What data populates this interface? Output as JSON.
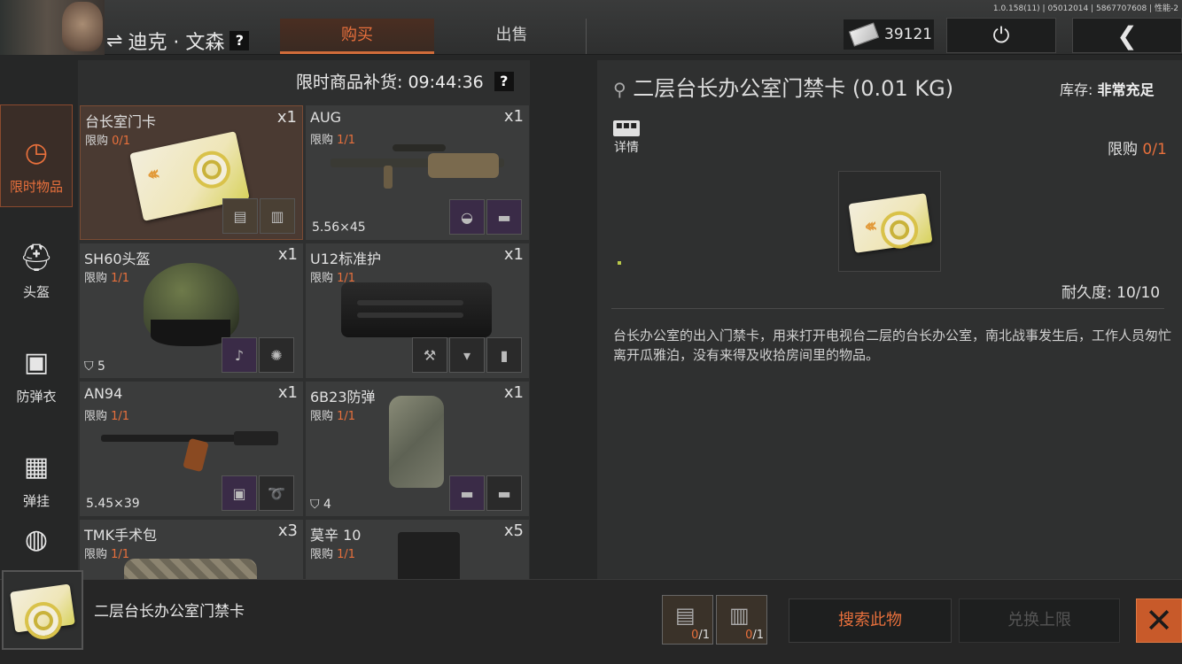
{
  "version": "1.0.158(11) | 05012014 | 5867707608 | 性能-2",
  "header": {
    "swap_icon": "⇌",
    "player_name": "迪克 · 文森",
    "help_label": "?",
    "tabs": [
      {
        "label": "购买",
        "active": true
      },
      {
        "label": "出售",
        "active": false
      }
    ],
    "currency_amount": "39121",
    "power_icon": "⏻",
    "back_icon": "❮"
  },
  "sidebar": {
    "items": [
      {
        "label": "限时物品",
        "icon": "clock-icon",
        "glyph": "◷",
        "active": true
      },
      {
        "label": "头盔",
        "icon": "helmet-icon",
        "glyph": "⛑",
        "active": false
      },
      {
        "label": "防弹衣",
        "icon": "vest-icon",
        "glyph": "▣",
        "active": false
      },
      {
        "label": "弹挂",
        "icon": "rig-icon",
        "glyph": "▦",
        "active": false
      },
      {
        "label": "",
        "icon": "backpack-icon",
        "glyph": "◍",
        "active": false
      }
    ]
  },
  "restock": {
    "label": "限时商品补货: 09:44:36",
    "help": "?"
  },
  "items": [
    {
      "name": "台长室门卡",
      "qty": "x1",
      "limit_label": "限购",
      "limit": "0/1",
      "extra": ""
    },
    {
      "name": "AUG",
      "qty": "x1",
      "limit_label": "限购",
      "limit": "1/1",
      "extra": "5.56×45"
    },
    {
      "name": "SH60头盔",
      "qty": "x1",
      "limit_label": "限购",
      "limit": "1/1",
      "extra": "5"
    },
    {
      "name": "U12标准护",
      "qty": "x1",
      "limit_label": "限购",
      "limit": "1/1",
      "extra": ""
    },
    {
      "name": "AN94",
      "qty": "x1",
      "limit_label": "限购",
      "limit": "1/1",
      "extra": "5.45×39"
    },
    {
      "name": "6B23防弹",
      "qty": "x1",
      "limit_label": "限购",
      "limit": "1/1",
      "extra": "4"
    },
    {
      "name": "TMK手术包",
      "qty": "x3",
      "limit_label": "限购",
      "limit": "1/1",
      "extra": ""
    },
    {
      "name": "莫辛 10",
      "qty": "x5",
      "limit_label": "限购",
      "limit": "1/1",
      "extra": ""
    }
  ],
  "detail": {
    "title": "二层台长办公室门禁卡 (0.01 KG)",
    "stock_label": "库存:",
    "stock_value": "非常充足",
    "info_label": "详情",
    "limit_label": "限购",
    "limit_value": "0/1",
    "durability": "耐久度: 10/10",
    "description": "台长办公室的出入门禁卡，用来打开电视台二层的台长办公室，南北战事发生后，工作人员匆忙离开瓜雅泊，没有来得及收拾房间里的物品。"
  },
  "bottom": {
    "item_name": "二层台长办公室门禁卡",
    "requirements": [
      {
        "have": "0",
        "need": "/1"
      },
      {
        "have": "0",
        "need": "/1"
      }
    ],
    "search_button": "搜索此物",
    "exchange_button": "兑换上限",
    "close_icon": "✕"
  },
  "colors": {
    "accent": "#e8703c",
    "panel": "#2e2f2f",
    "rare_bg": "#3a2b47"
  }
}
